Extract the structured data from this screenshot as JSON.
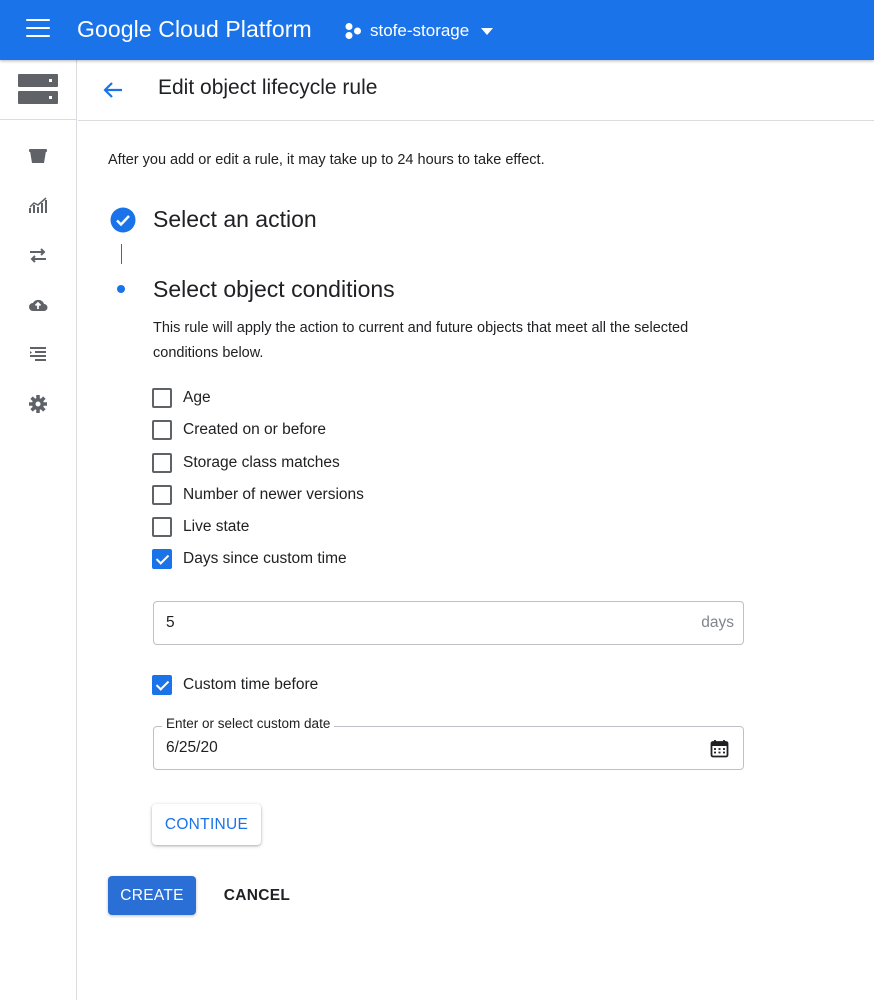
{
  "topbar": {
    "menu_icon": "hamburger-menu-icon",
    "brand": "Google Cloud Platform",
    "project_icon": "project-nodes-icon",
    "project_name": "stofe-storage",
    "dropdown_icon": "caret-down-icon",
    "accent_color": "#1a73e8"
  },
  "sidebar": {
    "header_icon": "storage-icon",
    "items": [
      {
        "icon": "bucket-icon"
      },
      {
        "icon": "monitoring-chart-icon"
      },
      {
        "icon": "transfer-arrows-icon"
      },
      {
        "icon": "cloud-upload-icon"
      },
      {
        "icon": "list-icon"
      },
      {
        "icon": "settings-gear-icon"
      }
    ]
  },
  "header": {
    "back_icon": "arrow-back-icon",
    "title": "Edit object lifecycle rule"
  },
  "notice": "After you add or edit a rule, it may take up to 24 hours to take effect.",
  "steps": {
    "step1": {
      "title": "Select an action",
      "status": "complete"
    },
    "step2": {
      "title": "Select object conditions",
      "description": "This rule will apply the action to current and future objects that meet all the selected conditions below."
    }
  },
  "conditions": [
    {
      "label": "Age",
      "checked": false
    },
    {
      "label": "Created on or before",
      "checked": false
    },
    {
      "label": "Storage class matches",
      "checked": false
    },
    {
      "label": "Number of newer versions",
      "checked": false
    },
    {
      "label": "Live state",
      "checked": false
    },
    {
      "label": "Days since custom time",
      "checked": true
    }
  ],
  "days_field": {
    "value": "5",
    "suffix": "days"
  },
  "custom_time_before": {
    "label": "Custom time before",
    "checked": true
  },
  "date_field": {
    "label": "Enter or select custom date",
    "value": "6/25/20",
    "icon": "calendar-icon"
  },
  "buttons": {
    "continue": "CONTINUE",
    "create": "CREATE",
    "cancel": "CANCEL"
  }
}
